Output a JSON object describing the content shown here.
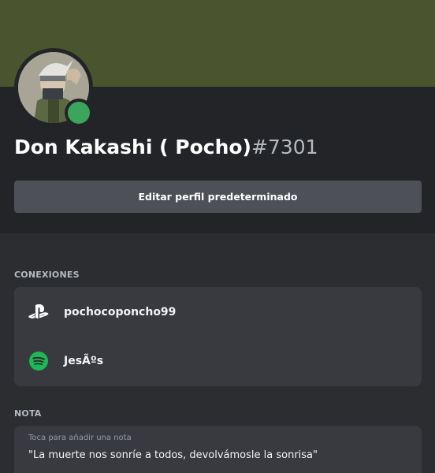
{
  "profile": {
    "display_name": "Don Kakashi ( Pocho)",
    "discriminator": "#7301",
    "banner_color": "#4a5530",
    "status_color": "#3ba55c",
    "status_icon": "online-status-icon"
  },
  "actions": {
    "edit_profile_label": "Editar perfil predeterminado"
  },
  "connections": {
    "heading": "CONEXIONES",
    "items": [
      {
        "service_icon": "playstation-icon",
        "name": "pochocoponcho99"
      },
      {
        "service_icon": "spotify-icon",
        "name": "JesÃºs"
      }
    ]
  },
  "note": {
    "heading": "NOTA",
    "placeholder": "Toca para añadir una nota",
    "text": "\"La muerte nos sonríe a todos, devolvámosle la sonrisa\""
  }
}
